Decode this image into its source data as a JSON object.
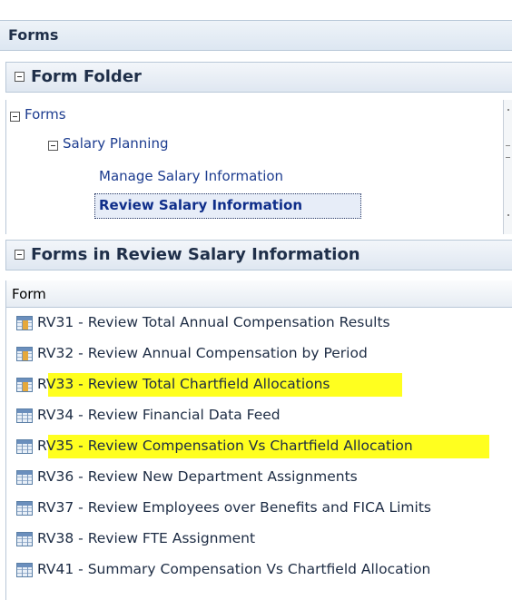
{
  "header": {
    "title": "Forms"
  },
  "folder_panel": {
    "title": "Form Folder",
    "tree": [
      {
        "label": "Forms"
      },
      {
        "label": "Salary Planning"
      },
      {
        "label": "Manage Salary Information"
      },
      {
        "label": "Review Salary Information",
        "selected": true
      }
    ]
  },
  "forms_panel": {
    "title": "Forms in Review Salary Information",
    "column": "Form",
    "rows": [
      {
        "label": "RV31 - Review Total Annual Compensation Results",
        "highlighted": false,
        "icon": "form-grid-icon"
      },
      {
        "label": "RV32 - Review Annual Compensation by Period",
        "highlighted": false,
        "icon": "form-grid-icon"
      },
      {
        "label": "RV33 - Review Total Chartfield Allocations",
        "highlighted": true,
        "icon": "form-grid-icon"
      },
      {
        "label": "RV34 - Review Financial Data Feed",
        "highlighted": false,
        "icon": "form-grid-icon"
      },
      {
        "label": "RV35 - Review Compensation Vs Chartfield Allocation",
        "highlighted": true,
        "icon": "form-grid-icon"
      },
      {
        "label": "RV36 - Review New Department Assignments",
        "highlighted": false,
        "icon": "form-grid-icon"
      },
      {
        "label": "RV37 - Review Employees over Benefits and FICA Limits",
        "highlighted": false,
        "icon": "form-grid-icon"
      },
      {
        "label": "RV38 - Review FTE Assignment",
        "highlighted": false,
        "icon": "form-grid-icon"
      },
      {
        "label": "RV41 - Summary Compensation Vs Chartfield Allocation",
        "highlighted": false,
        "icon": "form-grid-icon"
      }
    ]
  },
  "colors": {
    "highlight": "#ffff1f",
    "link": "#1c3c8f",
    "selected_link": "#0f2e8a"
  }
}
